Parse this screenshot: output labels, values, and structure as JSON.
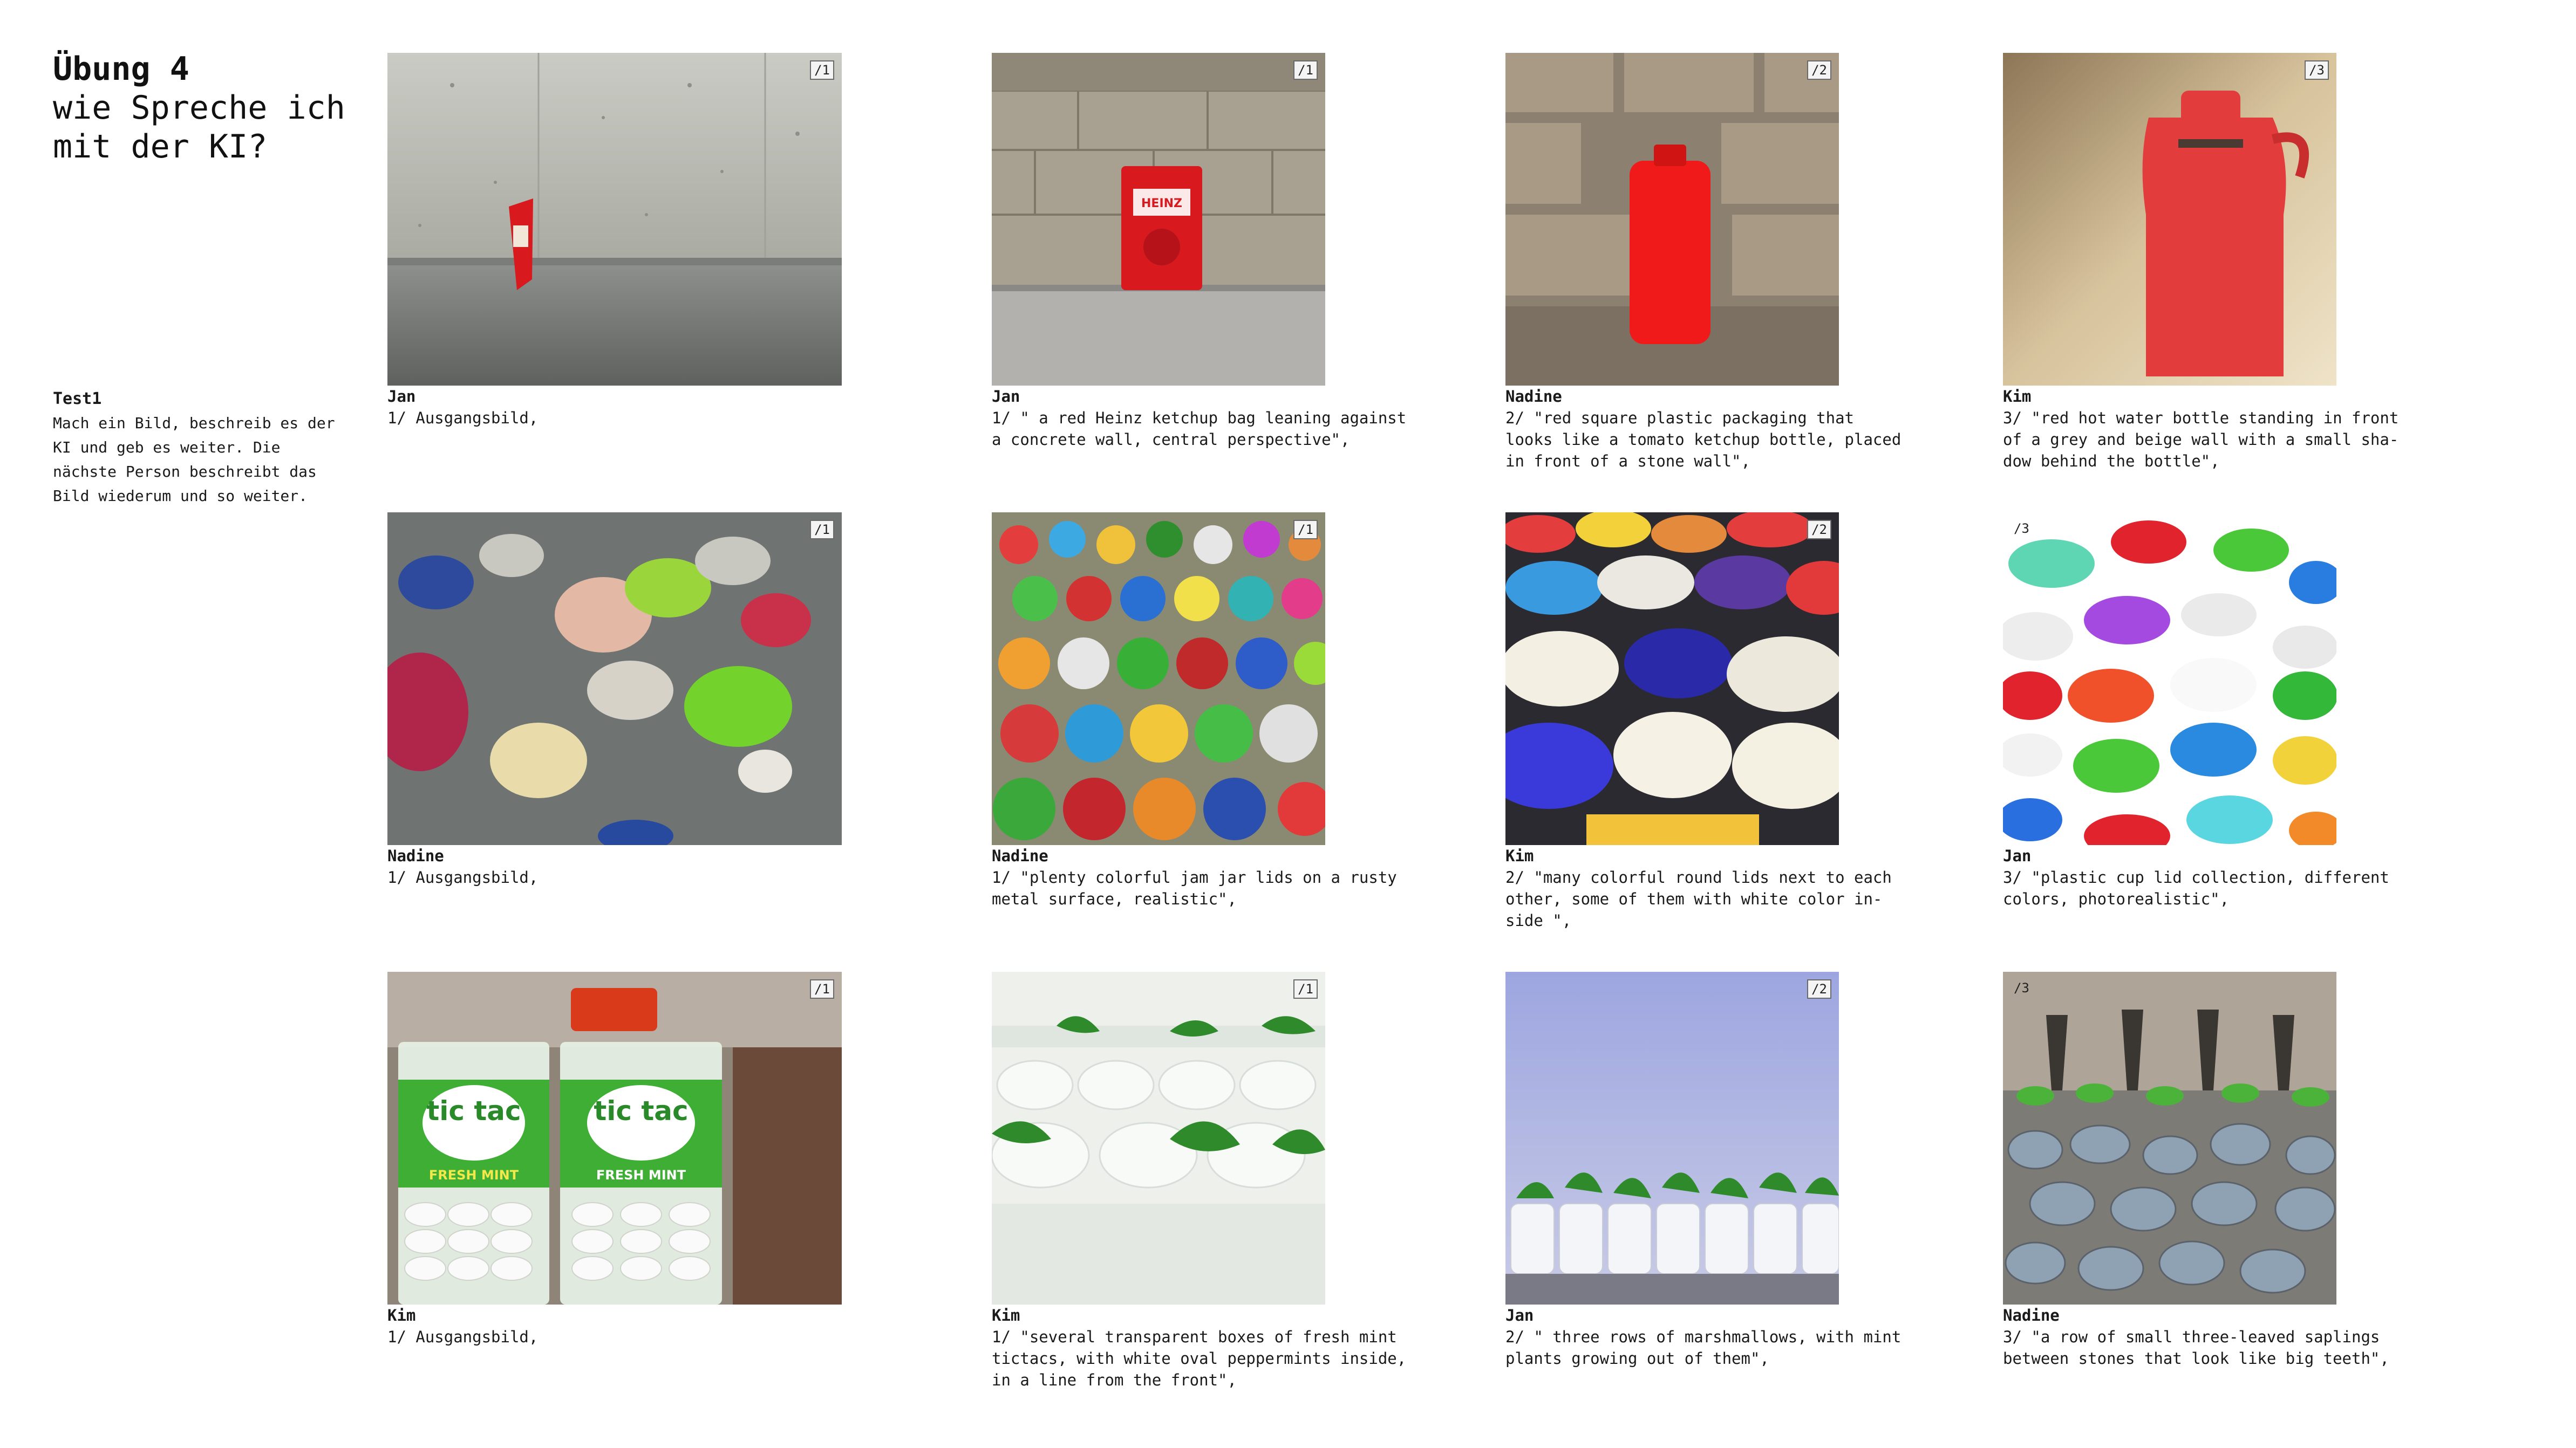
{
  "header": {
    "title_line1": "Übung 4",
    "title_line2": "wie Spreche ich",
    "title_line3": "mit der KI?"
  },
  "intro": {
    "heading": "Test1",
    "body": "Mach ein Bild, beschreib es der KI und geb es weiter. Die nächste Person beschreibt das Bild wiederum und so weiter."
  },
  "rows": [
    {
      "cards": [
        {
          "badge": "/1",
          "name": "Jan",
          "caption": "1/ Ausgangsbild,",
          "image": "red ketchup sachet leaning against concrete wall"
        },
        {
          "badge": "/1",
          "name": "Jan",
          "caption": "1/ \" a red Heinz ketchup bag leaning against\na concrete wall, central perspective\",",
          "image": "red ketchup bag in front of stone block wall"
        },
        {
          "badge": "/2",
          "name": "Nadine",
          "caption": "2/ \"red square plastic packaging that\nlooks like a tomato ketchup bottle, placed\nin front of a stone wall\",",
          "image": "red plastic bottle in front of stone wall"
        },
        {
          "badge": "/3",
          "name": "Kim",
          "caption": "3/ \"red hot water bottle standing in front\nof a grey and beige wall with a small sha-\ndow behind the bottle\",",
          "image": "red hot water bottle against beige wall"
        }
      ]
    },
    {
      "cards": [
        {
          "badge": "/1",
          "name": "Nadine",
          "caption": "1/ Ausgangsbild,",
          "image": "jam jar lids on metal surface"
        },
        {
          "badge": "/1",
          "name": "Nadine",
          "caption": "1/ \"plenty colorful jam jar lids on a rusty\nmetal surface, realistic\",",
          "image": "many colorful jar lids"
        },
        {
          "badge": "/2",
          "name": "Kim",
          "caption": "2/ \"many colorful round lids next to each\nother, some of them with white color in-\nside \",",
          "image": "stacked colorful round lids"
        },
        {
          "badge": "/3",
          "name": "Jan",
          "caption": "3/ \"plastic cup lid collection, different\ncolors, photorealistic\",",
          "image": "colorful plastic cup lids on white"
        }
      ]
    },
    {
      "cards": [
        {
          "badge": "/1",
          "name": "Kim",
          "caption": "1/ Ausgangsbild,",
          "image": "tic tac fresh mint boxes"
        },
        {
          "badge": "/1",
          "name": "Kim",
          "caption": "1/ \"several transparent boxes of fresh mint\ntictacs, with white oval peppermints inside,\nin a line from the front\",",
          "image": "white mints with mint leaves"
        },
        {
          "badge": "/2",
          "name": "Jan",
          "caption": "2/ \" three rows of marshmallows, with mint\nplants growing out of them\",",
          "image": "marshmallows with mint sprouts"
        },
        {
          "badge": "/3",
          "name": "Nadine",
          "caption": "3/ \"a row of small three-leaved saplings\nbetween stones that look like big teeth\",",
          "image": "saplings between stones"
        }
      ]
    }
  ],
  "brand": {
    "tictac_word": "tic tac",
    "tictac_sub": "FRESH MINT",
    "heinz_word": "HEINZ"
  },
  "colors": {
    "ketchup_red": "#d8191e",
    "mint_green": "#3fae35",
    "badge_border": "#6a6a6a"
  }
}
